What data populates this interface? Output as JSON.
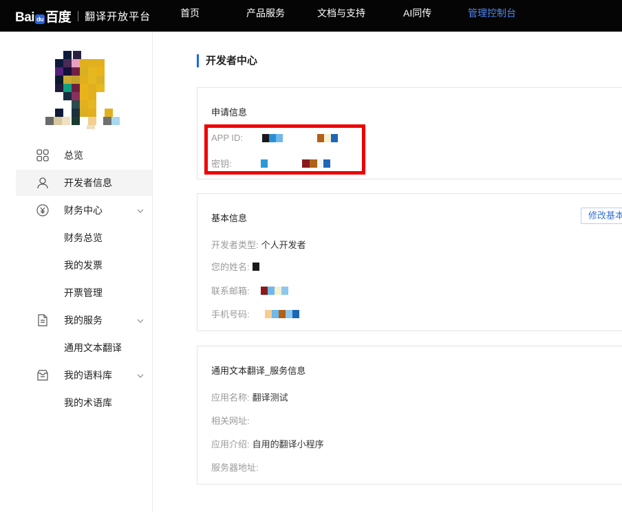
{
  "header": {
    "brand_logo_text": "Bai百度",
    "product_name": "翻译开放平台",
    "nav": [
      {
        "label": "首页"
      },
      {
        "label": "产品服务"
      },
      {
        "label": "文档与支持"
      },
      {
        "label": "AI同传"
      },
      {
        "label": "管理控制台"
      }
    ],
    "active_nav_color": "#4e86f5"
  },
  "sidebar": {
    "items": [
      {
        "label": "总览",
        "icon": "grid-icon"
      },
      {
        "label": "开发者信息",
        "icon": "user-icon",
        "active": true
      },
      {
        "label": "财务中心",
        "icon": "yen-icon",
        "expandable": true
      },
      {
        "label": "财务总览"
      },
      {
        "label": "我的发票"
      },
      {
        "label": "开票管理"
      },
      {
        "label": "我的服务",
        "icon": "document-icon",
        "expandable": true
      },
      {
        "label": "通用文本翻译"
      },
      {
        "label": "我的语料库",
        "icon": "inbox-icon",
        "expandable": true
      },
      {
        "label": "我的术语库"
      }
    ]
  },
  "main": {
    "title": "开发者中心",
    "application": {
      "title": "申请信息",
      "app_id_label": "APP ID:",
      "secret_label": "密钥:"
    },
    "basic": {
      "title": "基本信息",
      "edit_button": "修改基本",
      "dev_type_label": "开发者类型:",
      "dev_type_value": "个人开发者",
      "name_label": "您的姓名:",
      "email_label": "联系邮箱:",
      "phone_label": "手机号码:"
    },
    "service": {
      "title": "通用文本翻译_服务信息",
      "app_name_label": "应用名称:",
      "app_name_value": "翻译测试",
      "url_label": "相关网址:",
      "intro_label": "应用介绍:",
      "intro_value": "自用的翻译小程序",
      "server_label": "服务器地址:"
    }
  },
  "colors": {
    "accent": "#1a66e8",
    "highlight_box": "#ee0000"
  }
}
